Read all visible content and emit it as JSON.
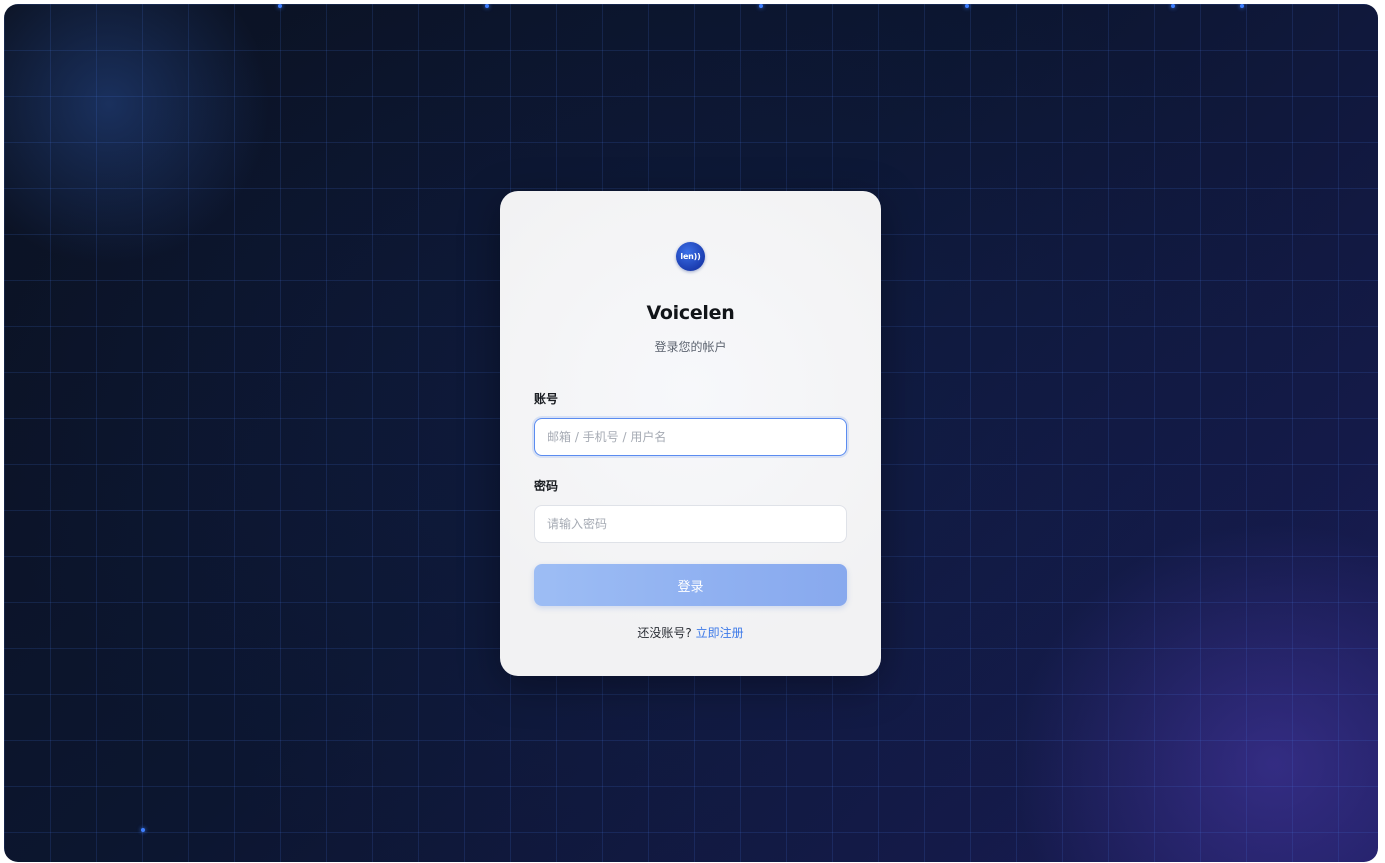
{
  "app": {
    "logo_text": "len))",
    "title": "Voicelen",
    "subtitle": "登录您的帐户"
  },
  "form": {
    "account_label": "账号",
    "account_placeholder": "邮箱 / 手机号 / 用户名",
    "password_label": "密码",
    "password_placeholder": "请输入密码",
    "submit_label": "登录",
    "register_prompt": "还没账号?",
    "register_link": "立即注册"
  },
  "colors": {
    "accent": "#3d7ae8",
    "button": "#94b4f2",
    "background": "#0c1630",
    "grid": "#2f58b8"
  }
}
